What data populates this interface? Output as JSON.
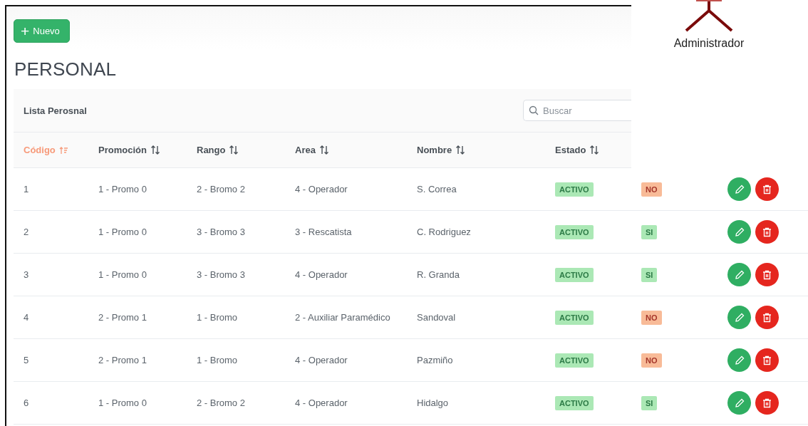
{
  "toolbar": {
    "new_button": {
      "icon": "+",
      "label": "Nuevo"
    }
  },
  "title": "PERSONAL",
  "card": {
    "title": "Lista Perosnal",
    "search": {
      "placeholder": "Buscar"
    }
  },
  "user": {
    "label": "Administrador"
  },
  "table": {
    "columns": [
      {
        "label": "Código",
        "sorted": true
      },
      {
        "label": "Promoción",
        "sorted": false
      },
      {
        "label": "Rango",
        "sorted": false
      },
      {
        "label": "Area",
        "sorted": false
      },
      {
        "label": "Nombre",
        "sorted": false
      },
      {
        "label": "Estado",
        "sorted": false
      }
    ],
    "rows": [
      {
        "codigo": "1",
        "promocion": "1 - Promo 0",
        "rango": "2 - Bromo 2",
        "area": "4 - Operador",
        "nombre": "S. Correa",
        "estado": {
          "text": "ACTIVO",
          "kind": "positive"
        },
        "flag": {
          "text": "NO",
          "kind": "negative"
        }
      },
      {
        "codigo": "2",
        "promocion": "1 - Promo 0",
        "rango": "3 - Bromo 3",
        "area": "3 - Rescatista",
        "nombre": "C. Rodriguez",
        "estado": {
          "text": "ACTIVO",
          "kind": "positive"
        },
        "flag": {
          "text": "SI",
          "kind": "positive"
        }
      },
      {
        "codigo": "3",
        "promocion": "1 - Promo 0",
        "rango": "3 - Bromo 3",
        "area": "4 - Operador",
        "nombre": "R. Granda",
        "estado": {
          "text": "ACTIVO",
          "kind": "positive"
        },
        "flag": {
          "text": "SI",
          "kind": "positive"
        }
      },
      {
        "codigo": "4",
        "promocion": "2 - Promo 1",
        "rango": "1 - Bromo",
        "area": "2 - Auxiliar Paramédico",
        "nombre": "Sandoval",
        "estado": {
          "text": "ACTIVO",
          "kind": "positive"
        },
        "flag": {
          "text": "NO",
          "kind": "negative"
        }
      },
      {
        "codigo": "5",
        "promocion": "2 - Promo 1",
        "rango": "1 - Bromo",
        "area": "4 - Operador",
        "nombre": "Pazmiño",
        "estado": {
          "text": "ACTIVO",
          "kind": "positive"
        },
        "flag": {
          "text": "NO",
          "kind": "negative"
        }
      },
      {
        "codigo": "6",
        "promocion": "1 - Promo 0",
        "rango": "2 - Bromo 2",
        "area": "4 - Operador",
        "nombre": "Hidalgo",
        "estado": {
          "text": "ACTIVO",
          "kind": "positive"
        },
        "flag": {
          "text": "SI",
          "kind": "positive"
        }
      }
    ]
  }
}
